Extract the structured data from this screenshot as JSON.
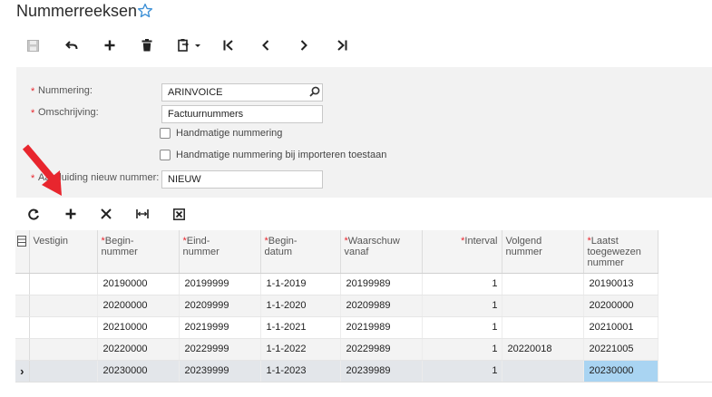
{
  "title": "Nummerreeksen",
  "form": {
    "nummering_label": "Nummering:",
    "nummering_value": "ARINVOICE",
    "omschrijving_label": "Omschrijving:",
    "omschrijving_value": "Factuurnummers",
    "handmatig_label": "Handmatige nummering",
    "handmatig_import_label": "Handmatige nummering bij importeren toestaan",
    "aanduiding_label": "Aanduiding nieuw nummer:",
    "aanduiding_value": "NIEUW",
    "required_mark": "*"
  },
  "grid": {
    "columns": [
      {
        "label": "Vestigin",
        "required": false
      },
      {
        "label": "Begin-\nnummer",
        "required": true
      },
      {
        "label": "Eind-\nnummer",
        "required": true
      },
      {
        "label": "Begin-\ndatum",
        "required": true
      },
      {
        "label": "Waarschuw\nvanaf",
        "required": true
      },
      {
        "label": "Interval",
        "required": true
      },
      {
        "label": "Volgend\nnummer",
        "required": false
      },
      {
        "label": "Laatst\ntoegewezen\nnummer",
        "required": true
      }
    ],
    "rows": [
      {
        "vestiging": "",
        "begin": "20190000",
        "eind": "20199999",
        "datum": "1-1-2019",
        "waarschuw": "20199989",
        "interval": "1",
        "volgend": "",
        "laatst": "20190013"
      },
      {
        "vestiging": "",
        "begin": "20200000",
        "eind": "20209999",
        "datum": "1-1-2020",
        "waarschuw": "20209989",
        "interval": "1",
        "volgend": "",
        "laatst": "20200000"
      },
      {
        "vestiging": "",
        "begin": "20210000",
        "eind": "20219999",
        "datum": "1-1-2021",
        "waarschuw": "20219989",
        "interval": "1",
        "volgend": "",
        "laatst": "20210001"
      },
      {
        "vestiging": "",
        "begin": "20220000",
        "eind": "20229999",
        "datum": "1-1-2022",
        "waarschuw": "20229989",
        "interval": "1",
        "volgend": "20220018",
        "laatst": "20221005"
      },
      {
        "vestiging": "",
        "begin": "20230000",
        "eind": "20239999",
        "datum": "1-1-2023",
        "waarschuw": "20239989",
        "interval": "1",
        "volgend": "",
        "laatst": "20230000"
      }
    ],
    "current_row_marker": "›"
  },
  "colors": {
    "accent": "#3b8fd6",
    "required": "#e8262e",
    "selection": "#a9d4f2",
    "arrow": "#e8262e"
  }
}
